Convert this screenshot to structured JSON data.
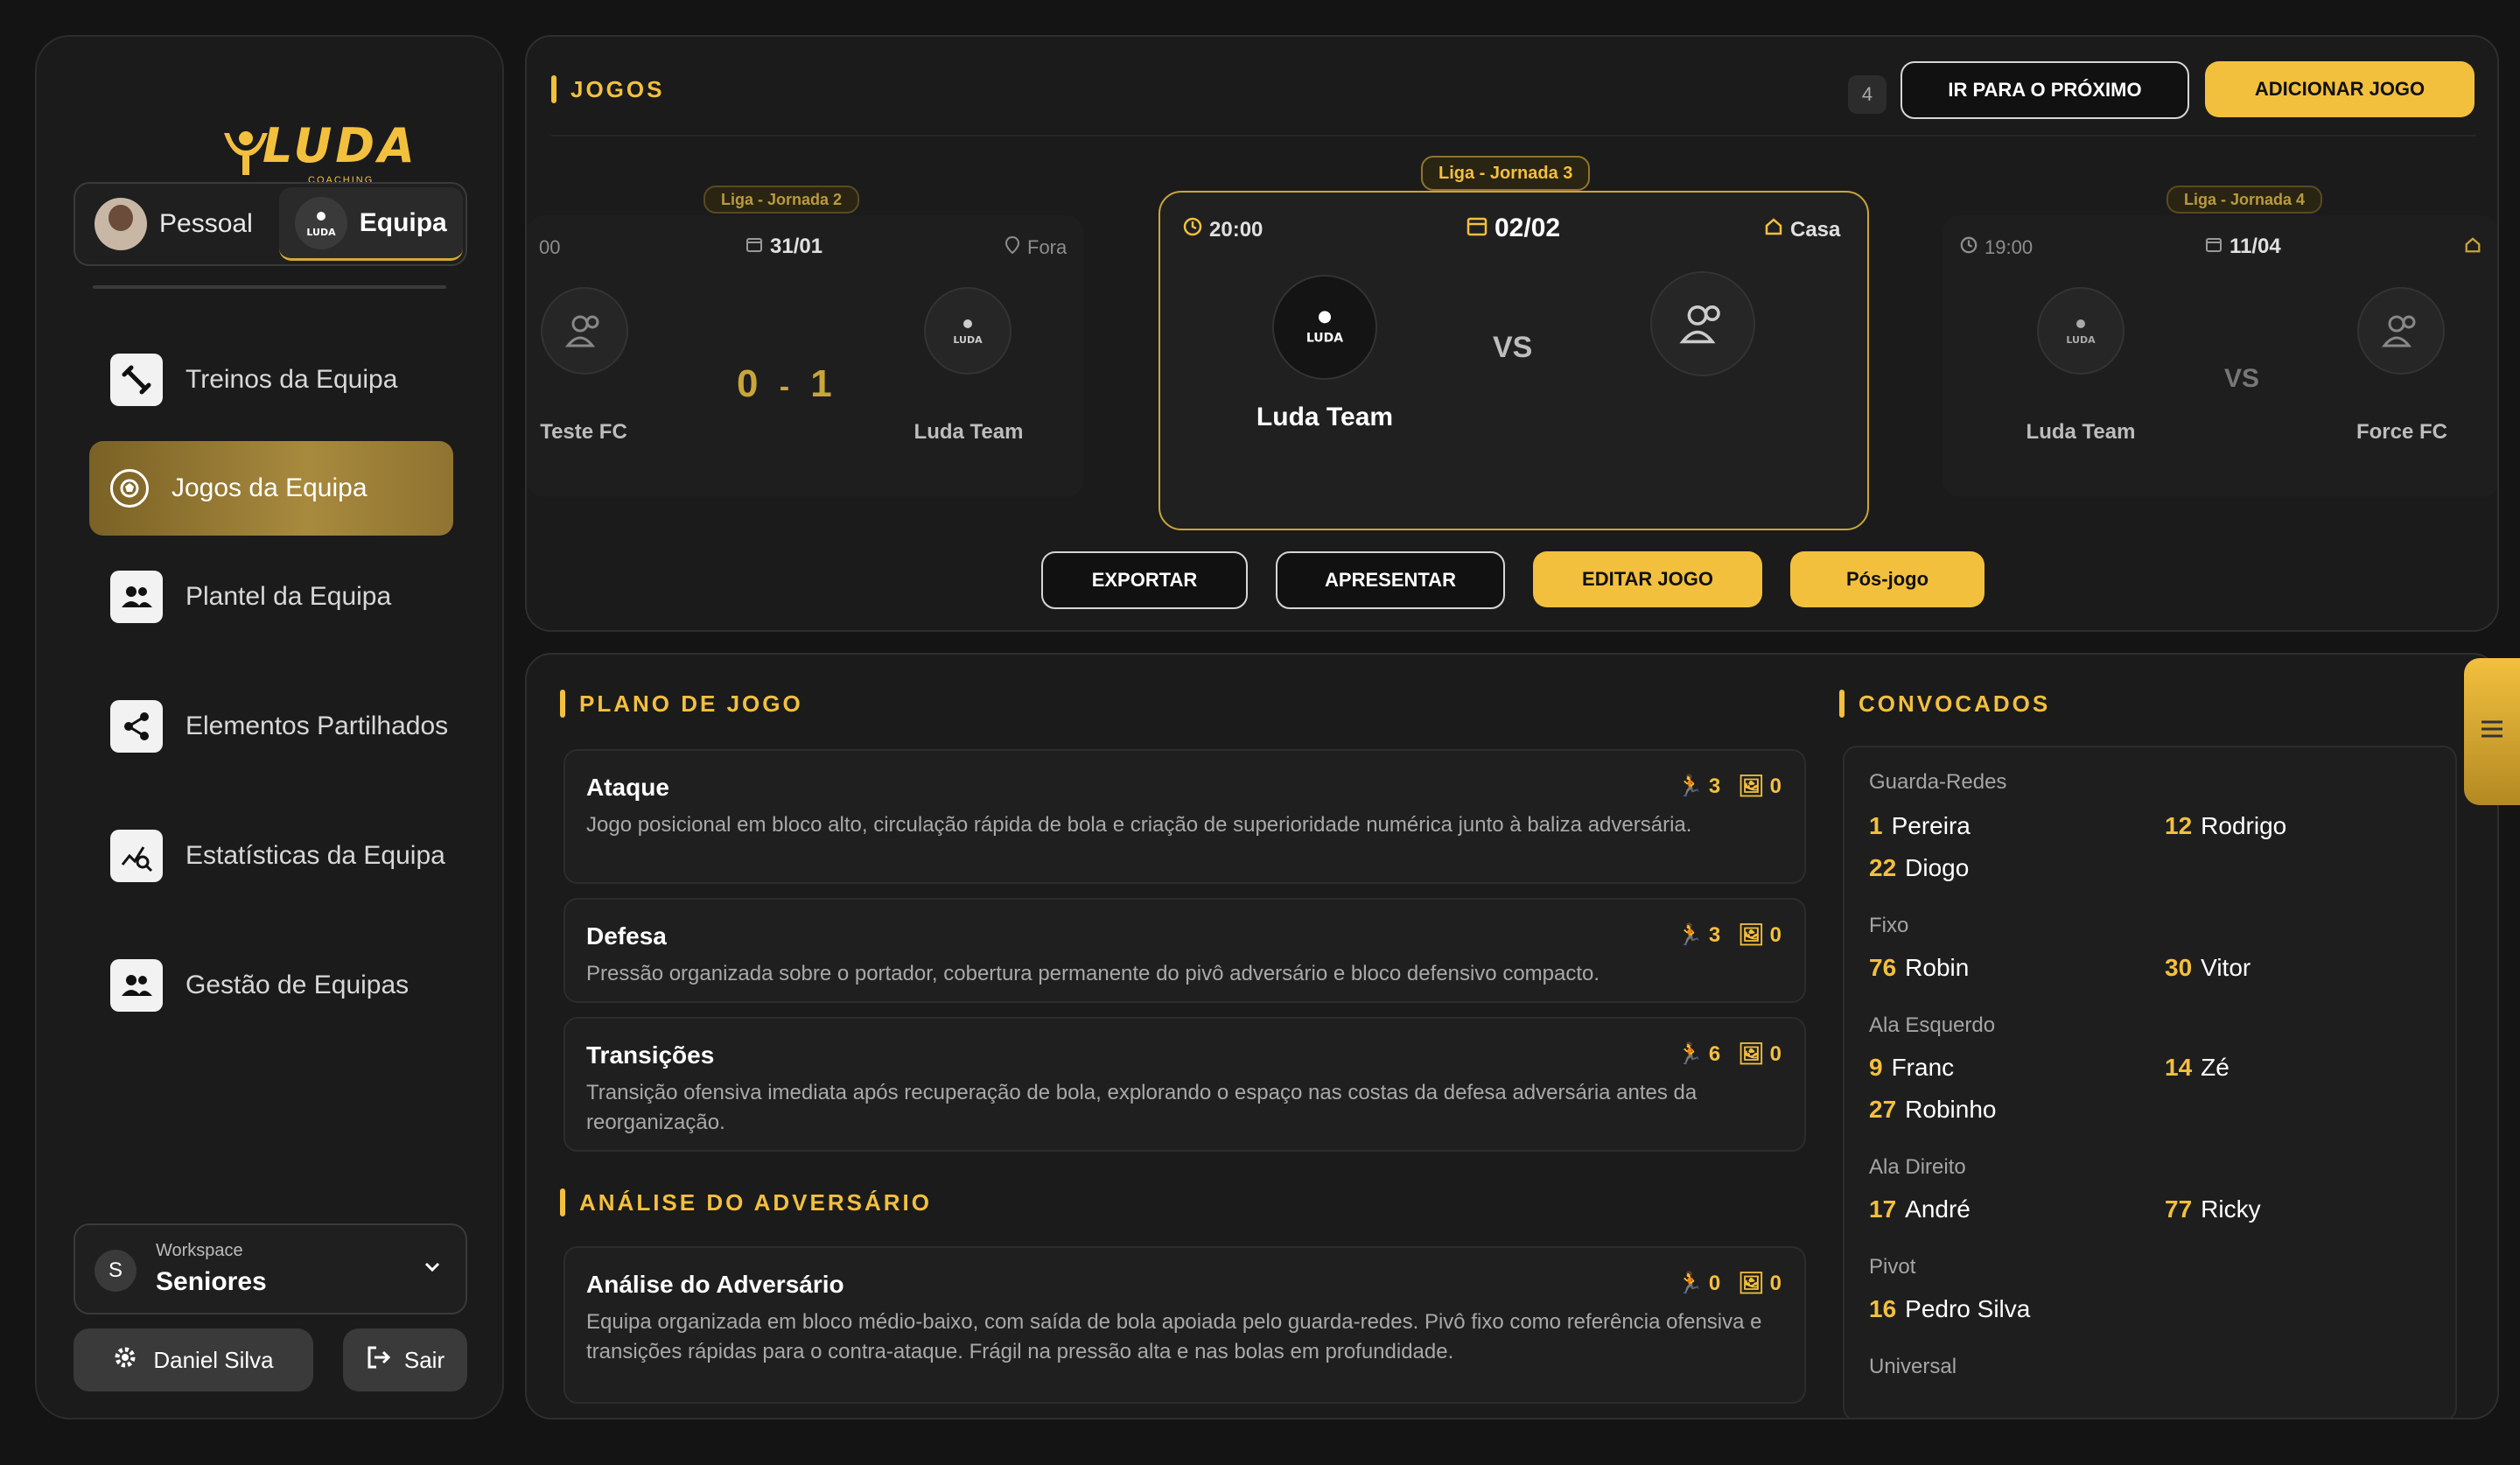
{
  "sidebar": {
    "logo_text": "LUDA",
    "logo_sub": "COACHING APP",
    "toggle": {
      "personal": "Pessoal",
      "team": "Equipa"
    },
    "nav": [
      {
        "label": "Treinos da Equipa",
        "icon": "dumbbell-icon"
      },
      {
        "label": "Jogos da Equipa",
        "icon": "soccer-ball-icon"
      },
      {
        "label": "Plantel da Equipa",
        "icon": "people-icon"
      },
      {
        "label": "Elementos Partilhados",
        "icon": "share-icon"
      },
      {
        "label": "Estatísticas da Equipa",
        "icon": "chart-search-icon"
      },
      {
        "label": "Gestão de Equipas",
        "icon": "group-icon"
      }
    ],
    "workspace": {
      "label": "Workspace",
      "value": "Seniores",
      "initial": "S"
    },
    "user": "Daniel Silva",
    "logout": "Sair"
  },
  "games": {
    "title": "JOGOS",
    "count": "4",
    "next_button": "IR PARA O PRÓXIMO",
    "add_button": "ADICIONAR JOGO",
    "matches": [
      {
        "round": "Liga - Jornada 2",
        "time": "00",
        "date": "31/01",
        "venue": "Fora",
        "home": "Teste FC",
        "away": "Luda Team",
        "home_score": "0",
        "separator": "-",
        "away_score": "1"
      },
      {
        "round": "Liga - Jornada 3",
        "time": "20:00",
        "date": "02/02",
        "venue": "Casa",
        "home": "Luda Team",
        "away": "",
        "vs": "VS"
      },
      {
        "round": "Liga - Jornada 4",
        "time": "19:00",
        "date": "11/04",
        "venue": "",
        "home": "Luda Team",
        "away": "Force FC",
        "vs": "VS"
      }
    ],
    "actions": {
      "export": "EXPORTAR",
      "present": "APRESENTAR",
      "edit": "EDITAR JOGO",
      "post": "Pós-jogo"
    }
  },
  "plan": {
    "title": "PLANO DE JOGO",
    "items": [
      {
        "title": "Ataque",
        "text": "Jogo posicional em bloco alto, circulação rápida de bola e criação de superioridade numérica junto à baliza adversária.",
        "exercises": "3",
        "media": "0"
      },
      {
        "title": "Defesa",
        "text": "Pressão organizada sobre o portador, cobertura permanente do pivô adversário e bloco defensivo compacto.",
        "exercises": "3",
        "media": "0"
      },
      {
        "title": "Transições",
        "text": "Transição ofensiva imediata após recuperação de bola, explorando o espaço nas costas da defesa adversária antes da reorganização.",
        "exercises": "6",
        "media": "0"
      }
    ],
    "opponent_title": "ANÁLISE DO ADVERSÁRIO",
    "opponent": {
      "title": "Análise do Adversário",
      "text": "Equipa organizada em bloco médio-baixo, com saída de bola apoiada pelo guarda-redes. Pivô fixo como referência ofensiva e transições rápidas para o contra-ataque. Frágil na pressão alta e nas bolas em profundidade.",
      "exercises": "0",
      "media": "0"
    }
  },
  "squad": {
    "title": "CONVOCADOS",
    "groups": [
      {
        "position": "Guarda-Redes",
        "players": [
          {
            "num": "1",
            "name": "Pereira"
          },
          {
            "num": "12",
            "name": "Rodrigo"
          },
          {
            "num": "22",
            "name": "Diogo"
          }
        ]
      },
      {
        "position": "Fixo",
        "players": [
          {
            "num": "76",
            "name": "Robin"
          },
          {
            "num": "30",
            "name": "Vitor"
          }
        ]
      },
      {
        "position": "Ala Esquerdo",
        "players": [
          {
            "num": "9",
            "name": "Franc"
          },
          {
            "num": "14",
            "name": "Zé"
          },
          {
            "num": "27",
            "name": "Robinho"
          }
        ]
      },
      {
        "position": "Ala Direito",
        "players": [
          {
            "num": "17",
            "name": "André"
          },
          {
            "num": "77",
            "name": "Ricky"
          }
        ]
      },
      {
        "position": "Pivot",
        "players": [
          {
            "num": "16",
            "name": "Pedro Silva"
          }
        ]
      },
      {
        "position": "Universal",
        "players": []
      }
    ]
  },
  "colors": {
    "accent": "#f3c03e",
    "background": "#141414",
    "panel": "#1b1b1b"
  }
}
